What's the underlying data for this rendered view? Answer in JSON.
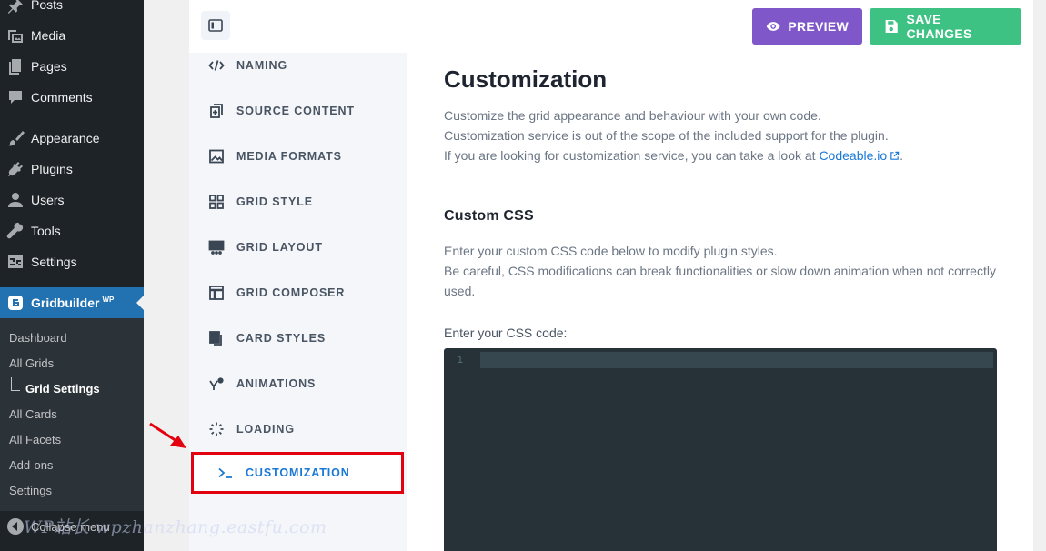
{
  "wp_menu": {
    "posts": "Posts",
    "media": "Media",
    "pages": "Pages",
    "comments": "Comments",
    "appearance": "Appearance",
    "plugins": "Plugins",
    "users": "Users",
    "tools": "Tools",
    "settings": "Settings",
    "gridbuilder": "Gridbuilder",
    "gridbuilder_sup": "WP",
    "collapse": "Collapse menu"
  },
  "wp_submenu": {
    "dashboard": "Dashboard",
    "all_grids": "All Grids",
    "grid_settings": "Grid Settings",
    "all_cards": "All Cards",
    "all_facets": "All Facets",
    "addons": "Add-ons",
    "settings": "Settings"
  },
  "toolbar": {
    "preview_label": "PREVIEW",
    "save_label": "SAVE CHANGES",
    "preview_color": "#7f57c9",
    "save_color": "#3dc284"
  },
  "plugin_nav": {
    "naming": "NAMING",
    "source_content": "SOURCE CONTENT",
    "media_formats": "MEDIA FORMATS",
    "grid_style": "GRID STYLE",
    "grid_layout": "GRID LAYOUT",
    "grid_composer": "GRID COMPOSER",
    "card_styles": "CARD STYLES",
    "animations": "ANIMATIONS",
    "loading": "LOADING",
    "customization": "CUSTOMIZATION"
  },
  "content": {
    "title": "Customization",
    "intro_line1": "Customize the grid appearance and behaviour with your own code.",
    "intro_line2": "Customization service is out of the scope of the included support for the plugin.",
    "intro_line3_prefix": "If you are looking for customization service, you can take a look at ",
    "intro_link": "Codeable.io",
    "intro_line3_suffix": ".",
    "section_title": "Custom CSS",
    "section_desc_line1": "Enter your custom CSS code below to modify plugin styles.",
    "section_desc_line2": "Be careful, CSS modifications can break functionalities or slow down animation when not correctly used.",
    "code_label": "Enter your CSS code:",
    "line_number": "1"
  },
  "watermark": "WP站长 wpzhanzhang.eastfu.com"
}
